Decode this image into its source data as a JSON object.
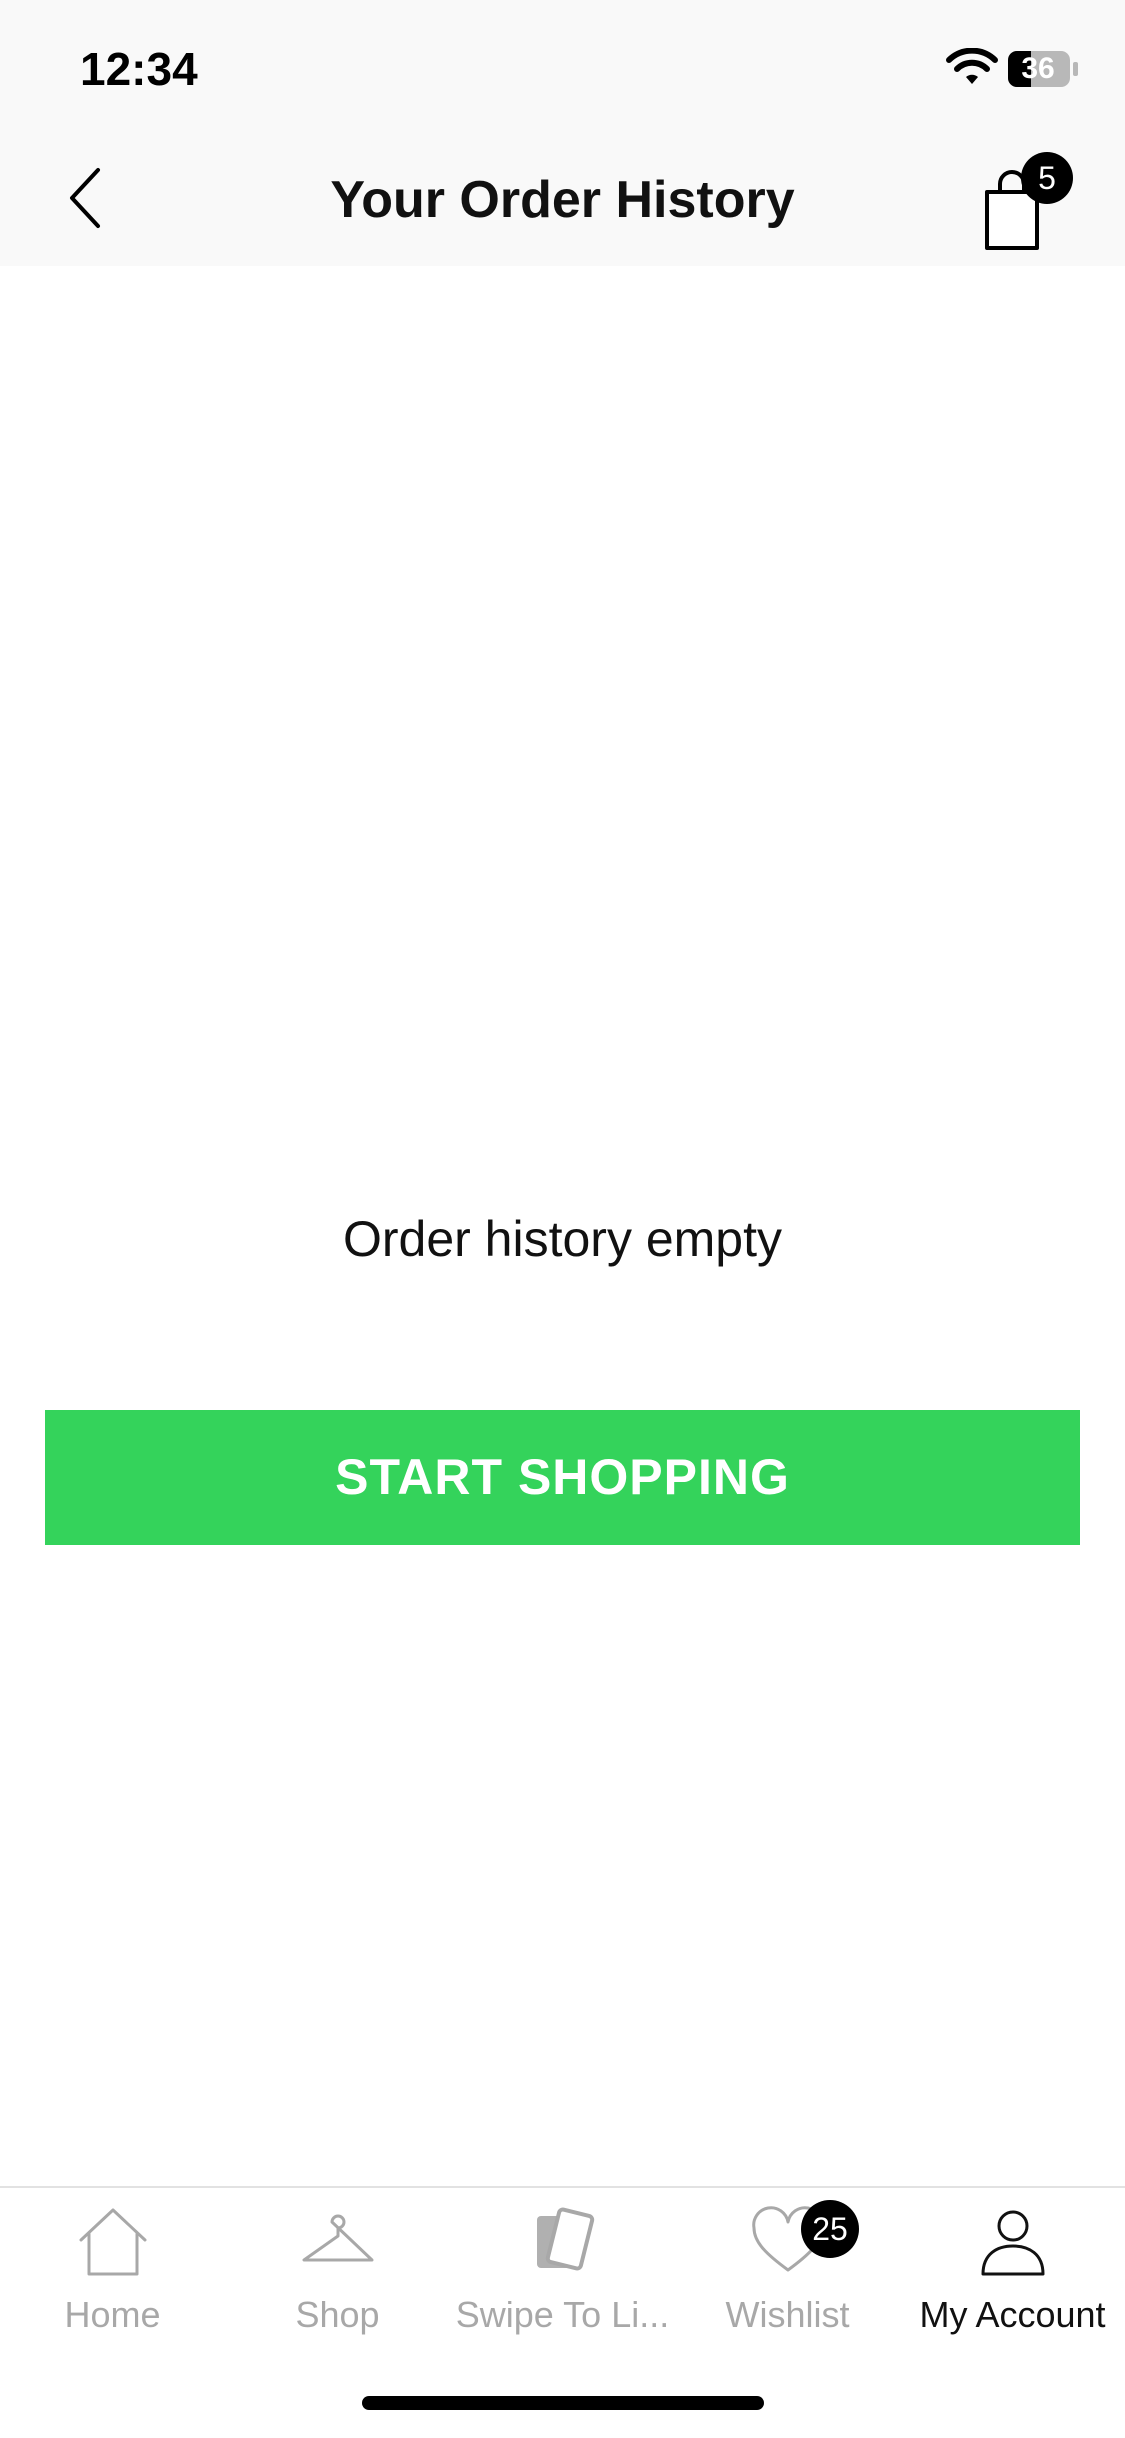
{
  "status_bar": {
    "time": "12:34",
    "battery": "36"
  },
  "nav": {
    "title": "Your Order History",
    "cart_count": "5"
  },
  "main": {
    "empty_message": "Order history empty",
    "cta_label": "START SHOPPING"
  },
  "tabs": [
    {
      "label": "Home",
      "icon": "home-icon"
    },
    {
      "label": "Shop",
      "icon": "hanger-icon"
    },
    {
      "label": "Swipe To Li...",
      "icon": "swipe-cards-icon"
    },
    {
      "label": "Wishlist",
      "icon": "heart-icon",
      "badge": "25"
    },
    {
      "label": "My Account",
      "icon": "person-icon",
      "active": true
    }
  ],
  "colors": {
    "accent": "#34d35b",
    "inactive_tab": "#a8a8a8",
    "active_tab": "#111111",
    "badge": "#000000"
  }
}
